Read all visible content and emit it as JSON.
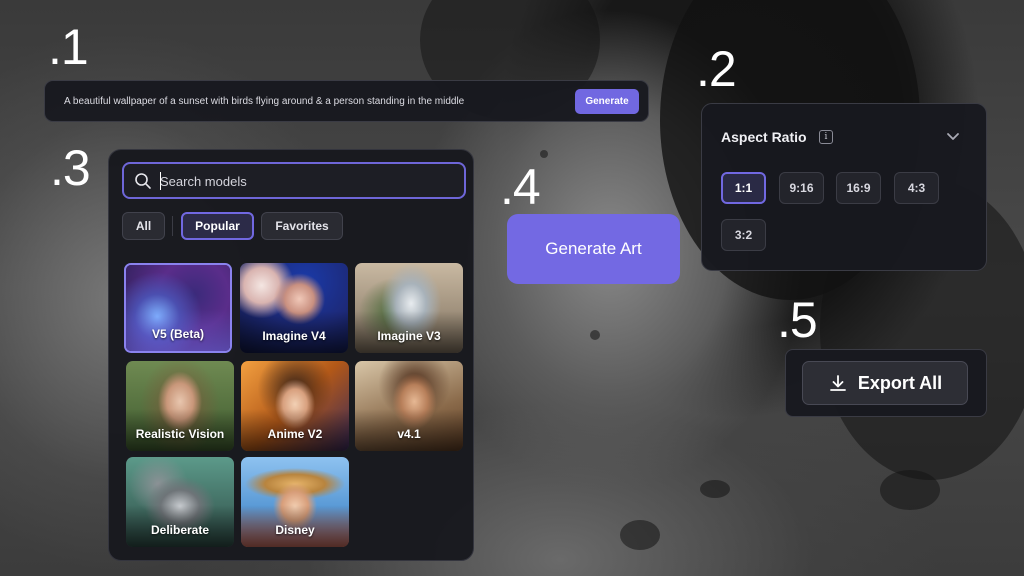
{
  "markers": {
    "m1": ".1",
    "m2": ".2",
    "m3": ".3",
    "m4": ".4",
    "m5": ".5"
  },
  "prompt": {
    "text": "A beautiful wallpaper of a sunset with birds flying around & a person standing in the middle",
    "generate_label": "Generate"
  },
  "aspect": {
    "title": "Aspect Ratio",
    "info_glyph": "i",
    "options": [
      "1:1",
      "9:16",
      "16:9",
      "4:3",
      "3:2"
    ],
    "selected": "1:1"
  },
  "models": {
    "search_placeholder": "Search models",
    "filters": [
      "All",
      "Popular",
      "Favorites"
    ],
    "active_filter": "Popular",
    "cards": [
      "V5 (Beta)",
      "Imagine V4",
      "Imagine V3",
      "Realistic Vision",
      "Anime V2",
      "v4.1",
      "Deliberate",
      "Disney"
    ],
    "selected_card": "V5 (Beta)"
  },
  "generate_art_label": "Generate Art",
  "export_label": "Export All",
  "colors": {
    "accent": "#7168e1",
    "panel": "#18191f",
    "border": "#3a3b44"
  },
  "icons": [
    "info-icon",
    "chevron-down-icon",
    "search-icon",
    "download-icon"
  ]
}
